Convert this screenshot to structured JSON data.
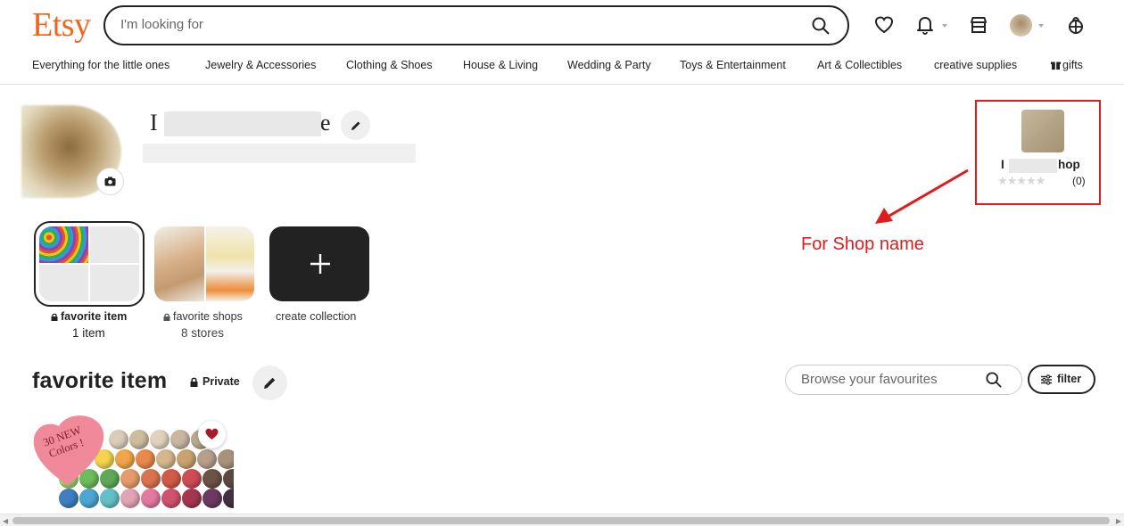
{
  "header": {
    "logo": "Etsy",
    "search_placeholder": "I'm looking for",
    "icons": [
      "search-icon",
      "heart-icon",
      "bell-icon",
      "shop-icon",
      "avatar",
      "cart-icon"
    ]
  },
  "categories": [
    "Everything for the little ones",
    "Jewelry & Accessories",
    "Clothing & Shoes",
    "House & Living",
    "Wedding & Party",
    "Toys & Entertainment",
    "Art & Collectibles",
    "creative supplies",
    "gifts"
  ],
  "profile": {
    "name_start": "I",
    "name_end": "e"
  },
  "shop_card": {
    "name_start": "I",
    "name_end": "hop",
    "review_count": "(0)",
    "rating_stars": 0
  },
  "annotation": {
    "text": "For Shop name",
    "color": "#e01b1b"
  },
  "collections": [
    {
      "title": "favorite item",
      "subtitle": "1 item",
      "locked": true,
      "selected": true
    },
    {
      "title": "favorite shops",
      "subtitle": "8 stores",
      "locked": true,
      "selected": false
    },
    {
      "title": "create collection",
      "subtitle": "",
      "locked": false,
      "selected": false
    }
  ],
  "section": {
    "title": "favorite item",
    "privacy": "Private",
    "search_placeholder": "Browse your favourites",
    "filter_label": "filter"
  },
  "listing": {
    "badge_line1": "30 NEW",
    "badge_line2": "Colors !"
  },
  "colors": {
    "brand": "#f1641e",
    "annotation": "#e01b1b",
    "favorite_heart": "#a61a2a"
  }
}
